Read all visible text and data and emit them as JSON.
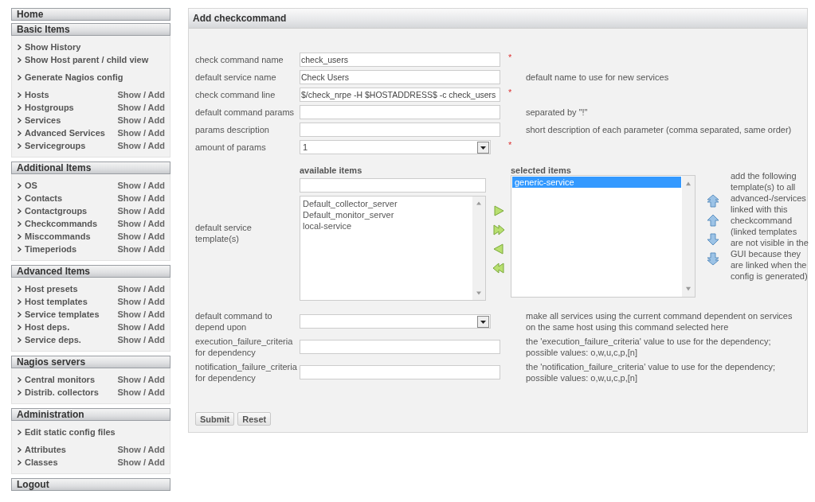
{
  "sidebar": {
    "sections": [
      {
        "title": "Home"
      },
      {
        "title": "Basic Items",
        "groups": [
          [
            {
              "label": "Show History"
            },
            {
              "label": "Show Host parent / child view"
            }
          ],
          [
            {
              "label": "Generate Nagios config"
            }
          ],
          [
            {
              "label": "Hosts",
              "action": "Show / Add"
            },
            {
              "label": "Hostgroups",
              "action": "Show / Add"
            },
            {
              "label": "Services",
              "action": "Show / Add"
            },
            {
              "label": "Advanced Services",
              "action": "Show / Add"
            },
            {
              "label": "Servicegroups",
              "action": "Show / Add"
            }
          ]
        ]
      },
      {
        "title": "Additional Items",
        "groups": [
          [
            {
              "label": "OS",
              "action": "Show / Add"
            },
            {
              "label": "Contacts",
              "action": "Show / Add"
            },
            {
              "label": "Contactgroups",
              "action": "Show / Add"
            },
            {
              "label": "Checkcommands",
              "action": "Show / Add"
            },
            {
              "label": "Misccommands",
              "action": "Show / Add"
            },
            {
              "label": "Timeperiods",
              "action": "Show / Add"
            }
          ]
        ]
      },
      {
        "title": "Advanced Items",
        "groups": [
          [
            {
              "label": "Host presets",
              "action": "Show / Add"
            },
            {
              "label": "Host templates",
              "action": "Show / Add"
            },
            {
              "label": "Service templates",
              "action": "Show / Add"
            },
            {
              "label": "Host deps.",
              "action": "Show / Add"
            },
            {
              "label": "Service deps.",
              "action": "Show / Add"
            }
          ]
        ]
      },
      {
        "title": "Nagios servers",
        "groups": [
          [
            {
              "label": "Central monitors",
              "action": "Show / Add"
            },
            {
              "label": "Distrib. collectors",
              "action": "Show / Add"
            }
          ]
        ]
      },
      {
        "title": "Administration",
        "groups": [
          [
            {
              "label": "Edit static config files"
            }
          ],
          [
            {
              "label": "Attributes",
              "action": "Show / Add"
            },
            {
              "label": "Classes",
              "action": "Show / Add"
            }
          ]
        ]
      },
      {
        "title": "Logout"
      }
    ]
  },
  "form": {
    "title": "Add checkcommand",
    "rows": [
      {
        "kind": "text",
        "label": "check command name",
        "value": "check_users",
        "required_mark": "*"
      },
      {
        "kind": "text",
        "label": "default service name",
        "value": "Check Users",
        "hint": "default name to use for new services"
      },
      {
        "kind": "text",
        "label": "check command line",
        "value": "$/check_nrpe -H $HOSTADDRESS$ -c check_users",
        "required_mark": "*"
      },
      {
        "kind": "text",
        "label": "default command params",
        "hint": "separated by \"!\""
      },
      {
        "kind": "text",
        "label": "params description",
        "hint": "short description of each parameter (comma separated, same order)"
      },
      {
        "kind": "select",
        "label": "amount of params",
        "value": "1",
        "required_mark": "*"
      },
      {
        "kind": "picker",
        "label": "default service template(s)",
        "available_title": "available items",
        "available_items": [
          {
            "label": "Default_collector_server",
            "selected": false
          },
          {
            "label": "Default_monitor_server",
            "selected": false
          },
          {
            "label": "local-service",
            "selected": false
          }
        ],
        "selected_title": "selected items",
        "selected_items": [
          {
            "label": "generic-service",
            "selected": true
          }
        ],
        "hint": "add the following template(s) to all advanced-/services linked with this checkcommand (linked templates are not visible in the GUI because they are linked when the config is generated)"
      },
      {
        "kind": "select",
        "label": "default command to depend upon",
        "hint": "make all services using the current command dependent on services on the same host using this command selected here"
      },
      {
        "kind": "text",
        "label": "execution_failure_criteria for dependency",
        "hint": "the 'execution_failure_criteria' value to use for the dependency; possible values: o,w,u,c,p,[n]"
      },
      {
        "kind": "text",
        "label": "notification_failure_criteria for dependency",
        "hint": "the 'notification_failure_criteria' value to use for the dependency; possible values: o,w,u,c,p,[n]"
      }
    ],
    "buttons": [
      "Submit",
      "Reset"
    ]
  }
}
